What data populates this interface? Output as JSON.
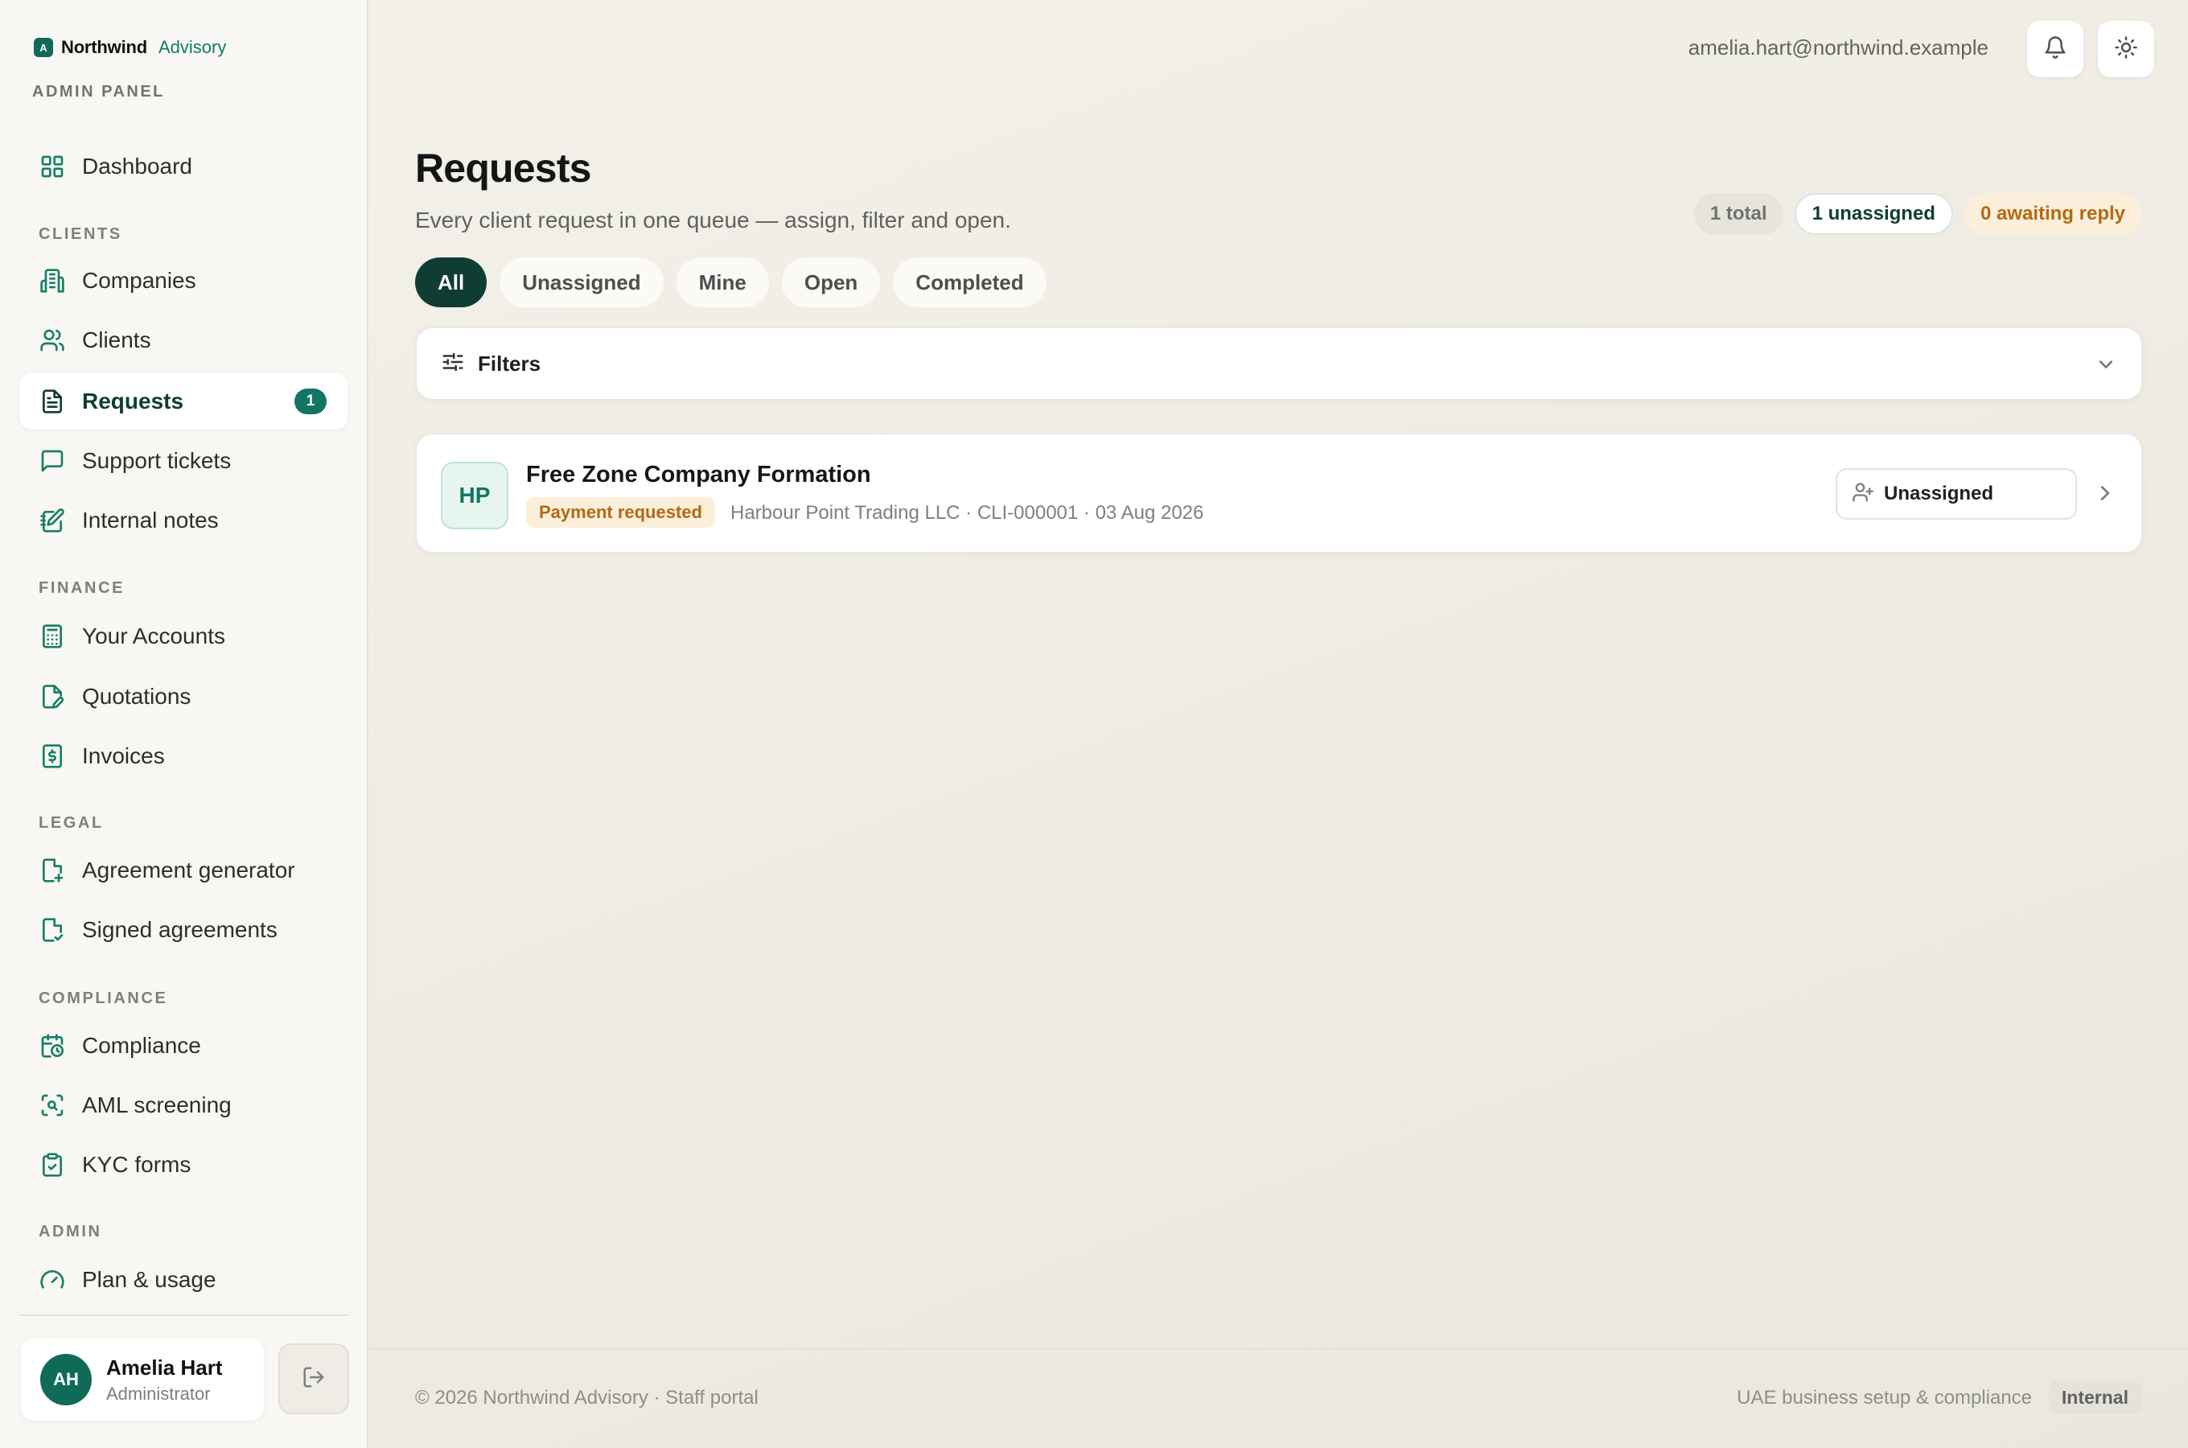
{
  "brand": {
    "mark": "A",
    "name": "Northwind",
    "suffix": "Advisory",
    "panel_label": "ADMIN PANEL"
  },
  "sidebar": {
    "top_item": {
      "label": "Dashboard",
      "icon": "grid-icon"
    },
    "sections": [
      {
        "label": "CLIENTS",
        "items": [
          {
            "label": "Companies",
            "icon": "building-icon"
          },
          {
            "label": "Clients",
            "icon": "users-icon"
          },
          {
            "label": "Requests",
            "icon": "file-text-icon",
            "active": true,
            "badge": "1"
          },
          {
            "label": "Support tickets",
            "icon": "message-square-icon"
          },
          {
            "label": "Internal notes",
            "icon": "edit-note-icon"
          }
        ]
      },
      {
        "label": "FINANCE",
        "items": [
          {
            "label": "Your Accounts",
            "icon": "calculator-icon"
          },
          {
            "label": "Quotations",
            "icon": "file-pen-icon"
          },
          {
            "label": "Invoices",
            "icon": "dollar-receipt-icon"
          }
        ]
      },
      {
        "label": "LEGAL",
        "items": [
          {
            "label": "Agreement generator",
            "icon": "file-plus-icon"
          },
          {
            "label": "Signed agreements",
            "icon": "file-check-icon"
          }
        ]
      },
      {
        "label": "COMPLIANCE",
        "items": [
          {
            "label": "Compliance",
            "icon": "calendar-clock-icon"
          },
          {
            "label": "AML screening",
            "icon": "scan-search-icon"
          },
          {
            "label": "KYC forms",
            "icon": "clipboard-check-icon"
          }
        ]
      },
      {
        "label": "ADMIN",
        "items": [
          {
            "label": "Plan & usage",
            "icon": "gauge-icon"
          }
        ]
      }
    ]
  },
  "user": {
    "initials": "AH",
    "name": "Amelia Hart",
    "role": "Administrator"
  },
  "header": {
    "email": "amelia.hart@northwind.example"
  },
  "main": {
    "title": "Requests",
    "subtitle": "Every client request in one queue — assign, filter and open.",
    "stats": {
      "total": "1 total",
      "unassigned": "1 unassigned",
      "awaiting": "0 awaiting reply"
    },
    "tabs": [
      "All",
      "Unassigned",
      "Mine",
      "Open",
      "Completed"
    ],
    "active_tab": "All",
    "filters_label": "Filters",
    "requests": [
      {
        "initials": "HP",
        "title": "Free Zone Company Formation",
        "status": "Payment requested",
        "meta": "Harbour Point Trading LLC · CLI-000001 · 03 Aug 2026",
        "assignee": "Unassigned"
      }
    ]
  },
  "footer": {
    "left": "© 2026 Northwind Advisory · Staff portal",
    "right": "UAE business setup & compliance",
    "badge": "Internal"
  },
  "colors": {
    "accent": "#0f6b57",
    "dark_accent": "#0f3d33",
    "warning": "#b2681a"
  }
}
